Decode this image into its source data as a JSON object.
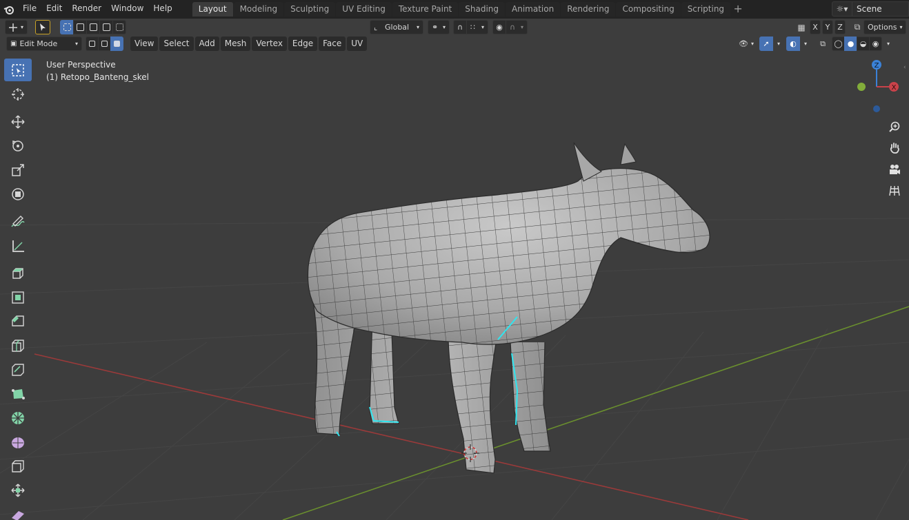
{
  "menubar": {
    "items": [
      "File",
      "Edit",
      "Render",
      "Window",
      "Help"
    ]
  },
  "workspaces": {
    "tabs": [
      "Layout",
      "Modeling",
      "Sculpting",
      "UV Editing",
      "Texture Paint",
      "Shading",
      "Animation",
      "Rendering",
      "Compositing",
      "Scripting"
    ],
    "active": "Layout"
  },
  "scene": {
    "name": "Scene"
  },
  "header1": {
    "transform_orientation": "Global",
    "axes": [
      "X",
      "Y",
      "Z"
    ],
    "options_label": "Options"
  },
  "header2": {
    "mode": "Edit Mode",
    "menus": [
      "View",
      "Select",
      "Add",
      "Mesh",
      "Vertex",
      "Edge",
      "Face",
      "UV"
    ]
  },
  "overlay": {
    "perspective": "User Perspective",
    "object": "(1) Retopo_Banteng_skel"
  },
  "gizmo": {
    "z": "Z",
    "x": "X"
  },
  "colors": {
    "accent": "#4772b3",
    "viewport_bg": "#3d3d3d",
    "x_axis": "#c9424a",
    "y_axis": "#82ad3a",
    "z_axis": "#3b82d8",
    "selected_edge": "#2ee6f0"
  },
  "icons": {
    "toolbar": [
      "select-box-icon",
      "cursor-icon",
      "move-icon",
      "rotate-icon",
      "scale-icon",
      "transform-icon",
      "annotate-icon",
      "measure-icon",
      "extrude-region-icon",
      "inset-faces-icon",
      "bevel-icon",
      "loop-cut-icon",
      "knife-icon",
      "poly-build-icon",
      "spin-icon",
      "smooth-icon",
      "edge-slide-icon",
      "shrink-fatten-icon",
      "shear-icon"
    ],
    "nav": [
      "zoom-icon",
      "hand-icon",
      "camera-icon",
      "grid-icon"
    ]
  }
}
